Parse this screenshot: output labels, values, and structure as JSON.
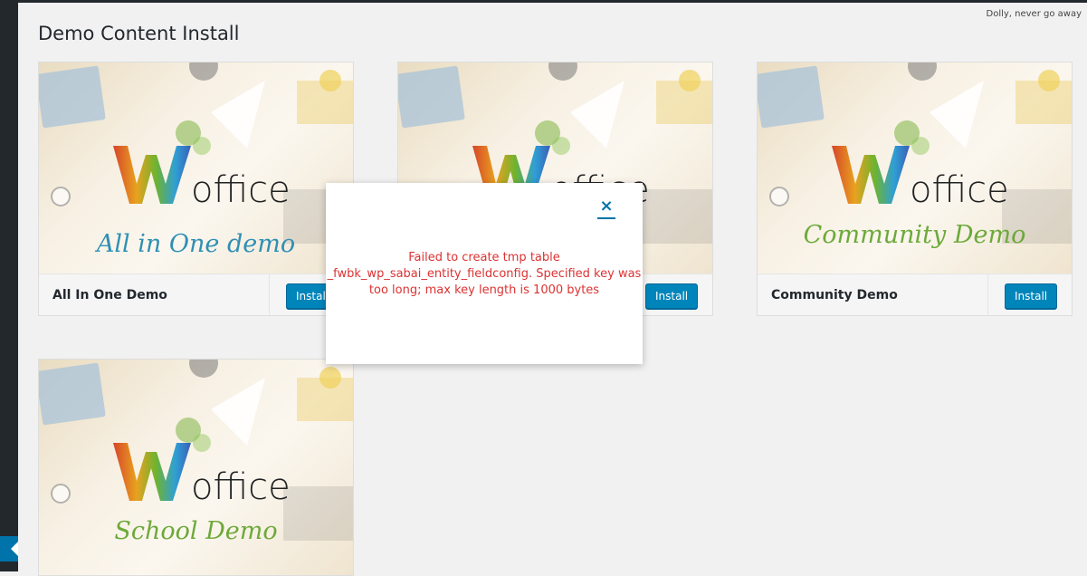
{
  "page": {
    "title": "Demo Content Install"
  },
  "header": {
    "dolly": "Dolly, never go away"
  },
  "brand": {
    "logo_letter": "W",
    "logo_word": "office"
  },
  "colors": {
    "install_button": "#0085ba",
    "error_text": "#dc3232",
    "close_icon": "#0073aa",
    "sidebar": "#23282d",
    "caption_blue": "#2f8fb5",
    "caption_green": "#6da93a"
  },
  "demos": [
    {
      "name": "All In One Demo",
      "caption": "All in One demo",
      "button": "Install"
    },
    {
      "name": "",
      "caption": "",
      "button": "Install"
    },
    {
      "name": "Community Demo",
      "caption": "Community Demo",
      "button": "Install"
    },
    {
      "name": "",
      "caption": "School Demo",
      "button": ""
    }
  ],
  "modal": {
    "close": "×",
    "message": "Failed to create tmp table _fwbk_wp_sabai_entity_fieldconfig. Specified key was too long; max key length is 1000 bytes"
  }
}
